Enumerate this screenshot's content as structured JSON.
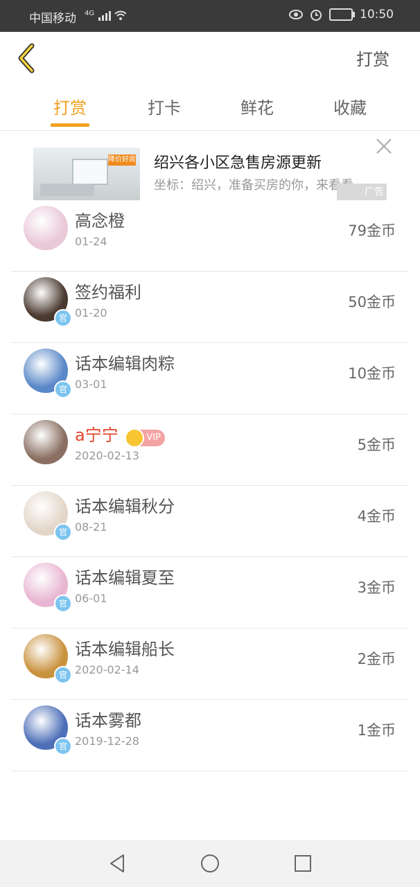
{
  "status": {
    "carrier": "中国移动",
    "network": "4G",
    "time": "10:50"
  },
  "header": {
    "right_label": "打赏"
  },
  "tabs": [
    {
      "label": "打赏"
    },
    {
      "label": "打卡"
    },
    {
      "label": "鲜花"
    },
    {
      "label": "收藏"
    }
  ],
  "ad": {
    "title": "绍兴各小区急售房源更新",
    "subtitle": "坐标：绍兴，准备买房的你，来看看",
    "label": "广告",
    "image_tag": "降价好房"
  },
  "badge_text": "官",
  "rows": [
    {
      "name": "高念橙",
      "date": "01-24",
      "amount": "79金币",
      "avatar_color": "#e9c8d8"
    },
    {
      "name": "签约福利",
      "date": "01-20",
      "amount": "50金币",
      "avatar_color": "#4a3a30"
    },
    {
      "name": "话本编辑肉粽",
      "date": "03-01",
      "amount": "10金币",
      "avatar_color": "#5a88c8"
    },
    {
      "name": "a宁宁",
      "date": "2020-02-13",
      "amount": "5金币",
      "avatar_color": "#8a6f62",
      "vip": "VIP"
    },
    {
      "name": "话本编辑秋分",
      "date": "08-21",
      "amount": "4金币",
      "avatar_color": "#e3d6c8"
    },
    {
      "name": "话本编辑夏至",
      "date": "06-01",
      "amount": "3金币",
      "avatar_color": "#e8b6d2"
    },
    {
      "name": "话本编辑船长",
      "date": "2020-02-14",
      "amount": "2金币",
      "avatar_color": "#c9923e"
    },
    {
      "name": "话本雾都",
      "date": "2019-12-28",
      "amount": "1金币",
      "avatar_color": "#4d6fb8"
    }
  ]
}
